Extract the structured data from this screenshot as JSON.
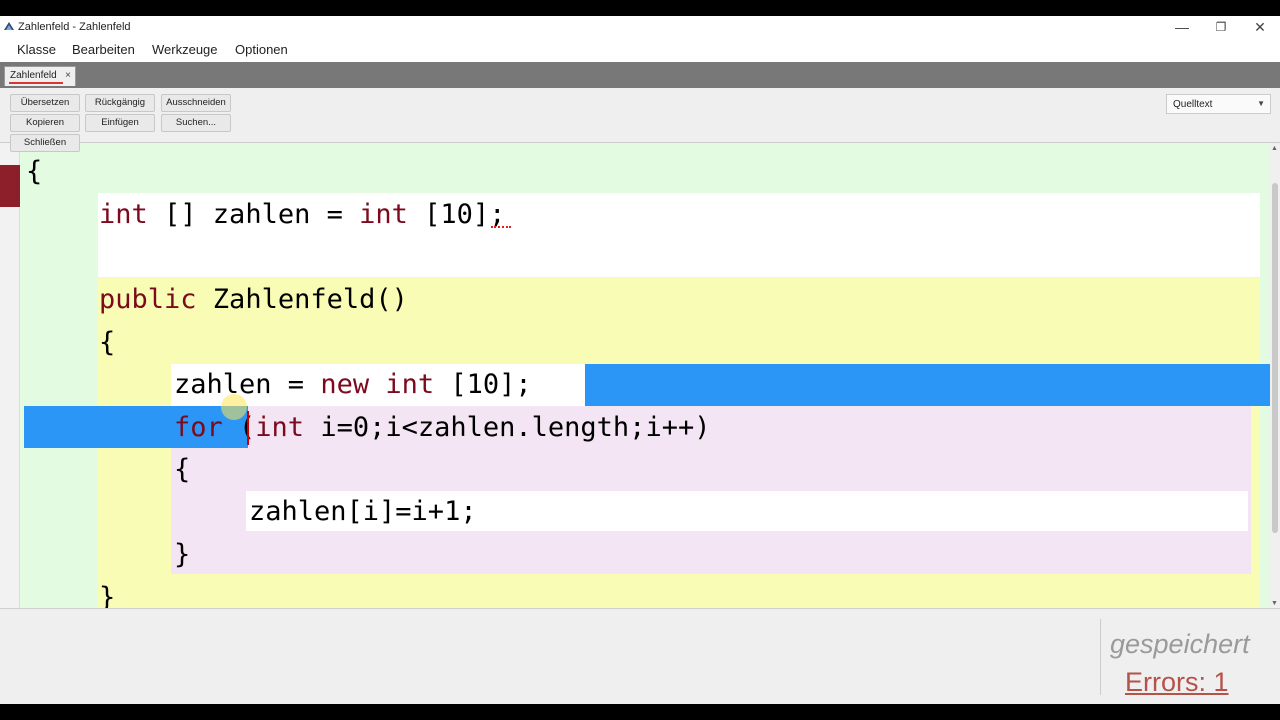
{
  "window": {
    "title": "Zahlenfeld - Zahlenfeld",
    "controls": {
      "minimize": "—",
      "restore": "❐",
      "close": "✕"
    }
  },
  "menu": [
    "Klasse",
    "Bearbeiten",
    "Werkzeuge",
    "Optionen"
  ],
  "tab": {
    "label": "Zahlenfeld",
    "close": "×"
  },
  "toolbar": {
    "buttons": [
      "Übersetzen",
      "Rückgängig",
      "Ausschneiden",
      "Kopieren",
      "Einfügen",
      "Suchen...",
      "Schließen"
    ],
    "view_select": "Quelltext"
  },
  "code": {
    "lines": [
      [
        {
          "t": "{",
          "k": false
        }
      ],
      [
        {
          "t": "int",
          "k": true
        },
        {
          "t": " [] zahlen = ",
          "k": false
        },
        {
          "t": "int",
          "k": true
        },
        {
          "t": " [10];",
          "k": false
        }
      ],
      [
        {
          "t": "public",
          "k": true
        },
        {
          "t": " Zahlenfeld()",
          "k": false
        }
      ],
      [
        {
          "t": "{",
          "k": false
        }
      ],
      [
        {
          "t": "zahlen = ",
          "k": false
        },
        {
          "t": "new",
          "k": true
        },
        {
          "t": " ",
          "k": false
        },
        {
          "t": "int",
          "k": true
        },
        {
          "t": " [10];",
          "k": false
        }
      ],
      [
        {
          "t": "for",
          "k": true
        },
        {
          "t": " (",
          "k": false
        },
        {
          "t": "int",
          "k": true
        },
        {
          "t": " i=0;i<zahlen.length;i++)",
          "k": false
        }
      ],
      [
        {
          "t": "{",
          "k": false
        }
      ],
      [
        {
          "t": "zahlen[i]=i+1;",
          "k": false
        }
      ],
      [
        {
          "t": "}",
          "k": false
        }
      ],
      [
        {
          "t": "}",
          "k": false
        }
      ]
    ]
  },
  "status": {
    "saved": "gespeichert",
    "errors": "Errors: 1"
  },
  "colors": {
    "keyword": "#7c0a1e",
    "class_scope": "#e3fbe1",
    "method_scope": "#f8fcb5",
    "loop_scope": "#f3e5f3",
    "selection": "#2b96f5",
    "error_mark": "#8c1f2a"
  }
}
